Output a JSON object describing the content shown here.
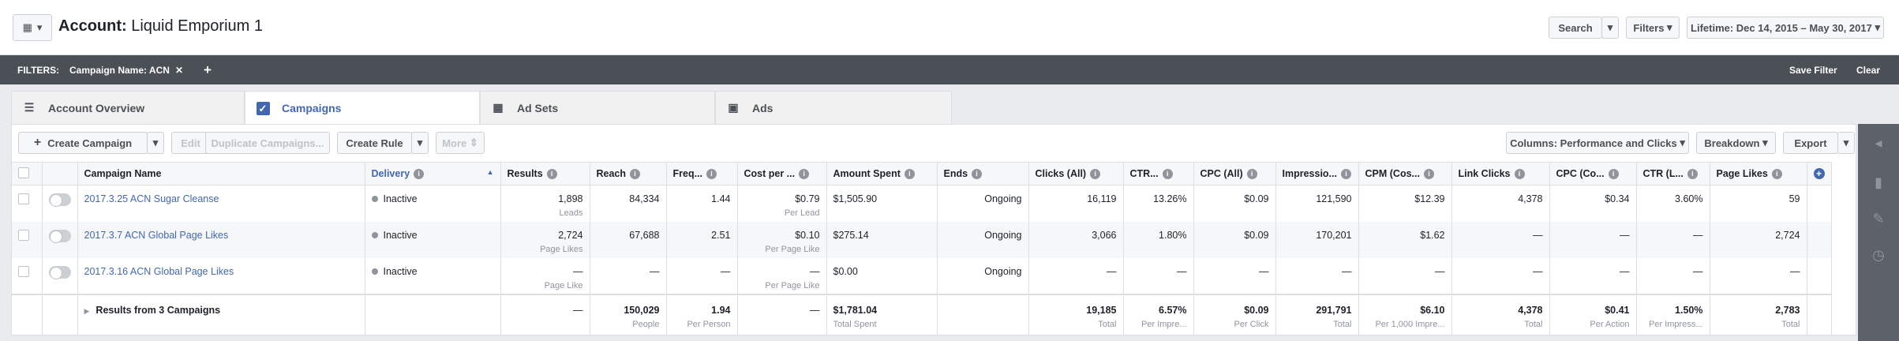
{
  "header": {
    "account_label": "Account:",
    "account_name": "Liquid Emporium 1",
    "search_label": "Search",
    "filters_label": "Filters",
    "date_range": "Lifetime: Dec 14, 2015 – May 30, 2017"
  },
  "filterbar": {
    "label": "FILTERS:",
    "chip": "Campaign Name:  ACN",
    "save_filter": "Save Filter",
    "clear": "Clear"
  },
  "tabs": [
    {
      "label": "Account Overview"
    },
    {
      "label": "Campaigns"
    },
    {
      "label": "Ad Sets"
    },
    {
      "label": "Ads"
    }
  ],
  "toolbar": {
    "create_campaign": "Create Campaign",
    "edit": "Edit",
    "duplicate": "Duplicate Campaigns...",
    "create_rule": "Create Rule",
    "more": "More",
    "columns": "Columns: Performance and Clicks",
    "breakdown": "Breakdown",
    "export": "Export"
  },
  "columns": [
    "Campaign Name",
    "Delivery",
    "Results",
    "Reach",
    "Freq...",
    "Cost per ...",
    "Amount Spent",
    "Ends",
    "Clicks (All)",
    "CTR...",
    "CPC (All)",
    "Impressio...",
    "CPM (Cos...",
    "Link Clicks",
    "CPC (Co...",
    "CTR (L...",
    "Page Likes"
  ],
  "rows": [
    {
      "name": "2017.3.25 ACN Sugar Cleanse",
      "delivery": "Inactive",
      "results": "1,898",
      "results_sub": "Leads",
      "reach": "84,334",
      "freq": "1.44",
      "cost": "$0.79",
      "cost_sub": "Per Lead",
      "spent": "$1,505.90",
      "ends": "Ongoing",
      "clicks": "16,119",
      "ctr": "13.26%",
      "cpc": "$0.09",
      "impr": "121,590",
      "cpm": "$12.39",
      "link": "4,378",
      "cpc2": "$0.34",
      "ctr2": "3.60%",
      "likes": "59"
    },
    {
      "name": "2017.3.7 ACN Global Page Likes",
      "delivery": "Inactive",
      "results": "2,724",
      "results_sub": "Page Likes",
      "reach": "67,688",
      "freq": "2.51",
      "cost": "$0.10",
      "cost_sub": "Per Page Like",
      "spent": "$275.14",
      "ends": "Ongoing",
      "clicks": "3,066",
      "ctr": "1.80%",
      "cpc": "$0.09",
      "impr": "170,201",
      "cpm": "$1.62",
      "link": "—",
      "cpc2": "—",
      "ctr2": "—",
      "likes": "2,724"
    },
    {
      "name": "2017.3.16 ACN Global Page Likes",
      "delivery": "Inactive",
      "results": "—",
      "results_sub": "Page Like",
      "reach": "—",
      "freq": "—",
      "cost": "—",
      "cost_sub": "Per Page Like",
      "spent": "$0.00",
      "ends": "Ongoing",
      "clicks": "—",
      "ctr": "—",
      "cpc": "—",
      "impr": "—",
      "cpm": "—",
      "link": "—",
      "cpc2": "—",
      "ctr2": "—",
      "likes": "—"
    }
  ],
  "totals": {
    "label": "Results from 3 Campaigns",
    "results": "—",
    "reach": "150,029",
    "reach_sub": "People",
    "freq": "1.94",
    "freq_sub": "Per Person",
    "cost": "—",
    "spent": "$1,781.04",
    "spent_sub": "Total Spent",
    "clicks": "19,185",
    "clicks_sub": "Total",
    "ctr": "6.57%",
    "ctr_sub": "Per Impre...",
    "cpc": "$0.09",
    "cpc_sub": "Per Click",
    "impr": "291,791",
    "impr_sub": "Total",
    "cpm": "$6.10",
    "cpm_sub": "Per 1,000 Impre...",
    "link": "4,378",
    "link_sub": "Total",
    "cpc2": "$0.41",
    "cpc2_sub": "Per Action",
    "ctr2": "1.50%",
    "ctr2_sub": "Per Impress...",
    "likes": "2,783",
    "likes_sub": "Total"
  },
  "colors": {
    "accent": "#4267b2",
    "filterbar": "#4b4f56",
    "rightbar": "#5d6168"
  }
}
